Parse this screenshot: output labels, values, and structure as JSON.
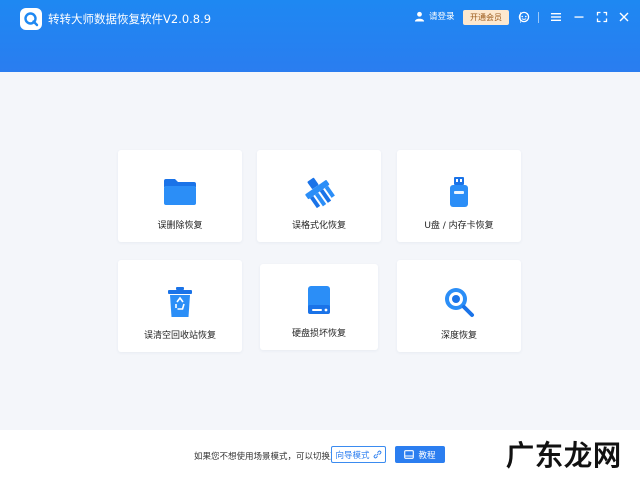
{
  "app": {
    "title": "转转大师数据恢复软件V2.0.8.9",
    "accent_color": "#2a7df0"
  },
  "header": {
    "login_label": "请登录",
    "vip_label": "开通会员",
    "icons": [
      "user-icon",
      "support-icon",
      "menu-icon",
      "minimize-icon",
      "maximize-icon",
      "close-icon"
    ]
  },
  "cards": [
    {
      "label": "误删除恢复",
      "icon": "folder-icon"
    },
    {
      "label": "误格式化恢复",
      "icon": "broom-icon"
    },
    {
      "label": "U盘 / 内存卡恢复",
      "icon": "usb-drive-icon"
    },
    {
      "label": "误清空回收站恢复",
      "icon": "recycle-bin-icon"
    },
    {
      "label": "硬盘损坏恢复",
      "icon": "hard-disk-icon"
    },
    {
      "label": "深度恢复",
      "icon": "deep-scan-icon"
    }
  ],
  "footer": {
    "tip": "如果您不想使用场景模式，可以切换至",
    "guide_label": "向导模式",
    "tutorial_label": "教程"
  },
  "watermark": "广东龙网"
}
